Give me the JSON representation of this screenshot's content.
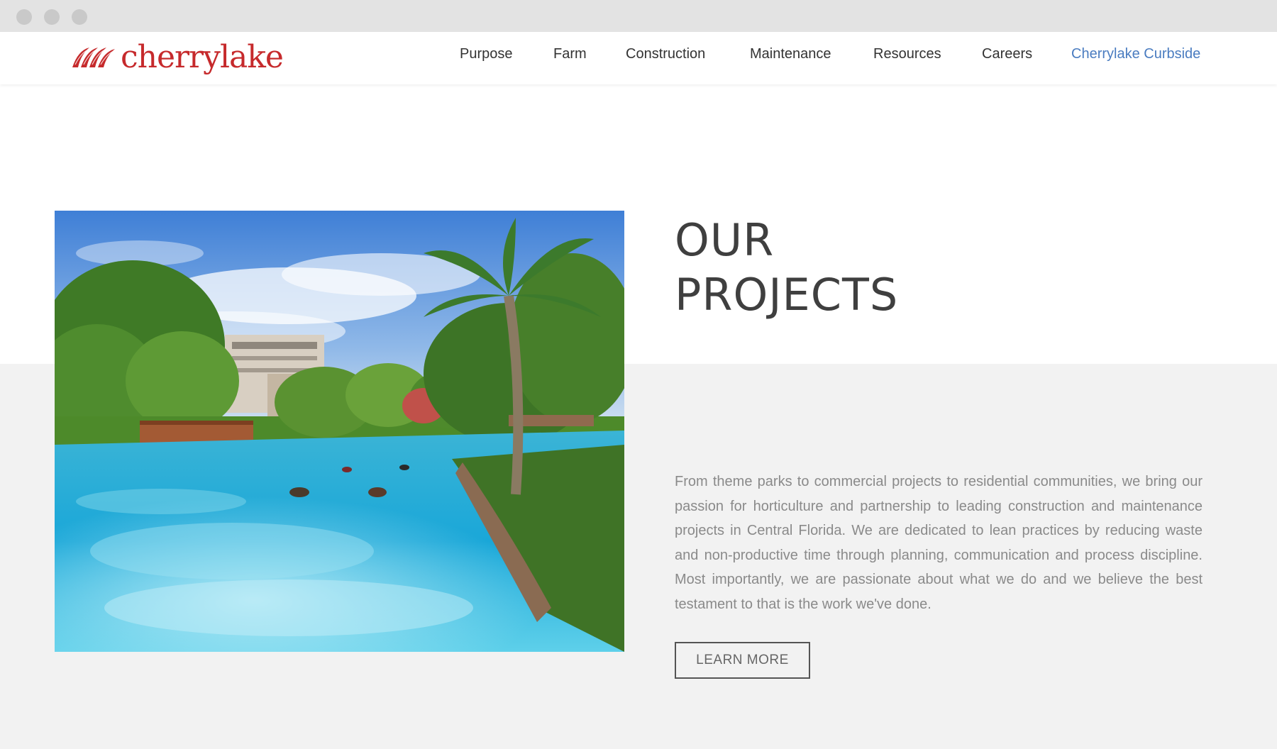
{
  "brand": {
    "name": "cherrylake",
    "color": "#c62a2c"
  },
  "nav": {
    "items": [
      {
        "label": "Purpose"
      },
      {
        "label": "Farm"
      },
      {
        "label": "Construction"
      },
      {
        "label": "Maintenance"
      },
      {
        "label": "Resources"
      },
      {
        "label": "Careers"
      },
      {
        "label": "Cherrylake Curbside",
        "accent": "#4a7cc0"
      }
    ]
  },
  "section": {
    "title_line1": "OUR",
    "title_line2": "PROJECTS",
    "description": "From theme parks to commercial projects to residential communities, we bring our passion for horticulture and partnership to leading construction and maintenance projects in Central Florida. We are dedicated to lean practices by reducing waste and non-productive time through planning, communication and process discipline. Most importantly, we are passionate about what we do and we believe the best testament to that is the work we've done.",
    "button_label": "LEARN MORE",
    "image": "tropical-lagoon-photo"
  }
}
